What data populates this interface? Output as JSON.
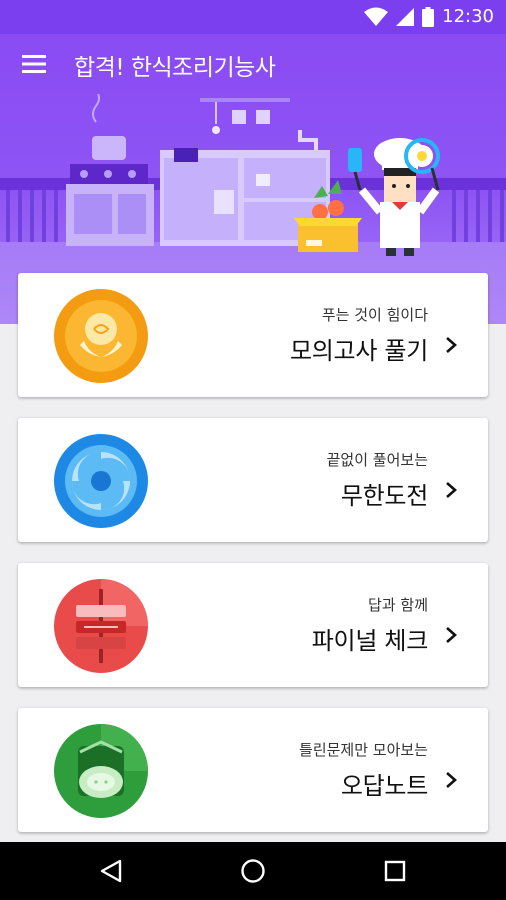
{
  "status_bar": {
    "time": "12:30",
    "icons": [
      "wifi-icon",
      "signal-icon",
      "battery-icon"
    ]
  },
  "app_bar": {
    "title": "합격! 한식조리기능사",
    "menu_icon": "hamburger-menu-icon"
  },
  "colors": {
    "primary": "#7b3ff0",
    "hero": "#8e55f4",
    "background": "#efeef1"
  },
  "cards": [
    {
      "subtitle": "푸는 것이 힘이다",
      "title": "모의고사 풀기",
      "icon": "noodle-bowl-icon",
      "icon_color": "#f7a21b"
    },
    {
      "subtitle": "끝없이 풀어보는",
      "title": "무한도전",
      "icon": "swirl-icon",
      "icon_color": "#2b9be6"
    },
    {
      "subtitle": "답과 함께",
      "title": "파이널 체크",
      "icon": "skewer-icon",
      "icon_color": "#ee5253"
    },
    {
      "subtitle": "틀린문제만 모아보는",
      "title": "오답노트",
      "icon": "cucumber-icon",
      "icon_color": "#43a047"
    }
  ],
  "nav_bar": {
    "buttons": [
      "back-icon",
      "home-icon",
      "recents-icon"
    ]
  }
}
